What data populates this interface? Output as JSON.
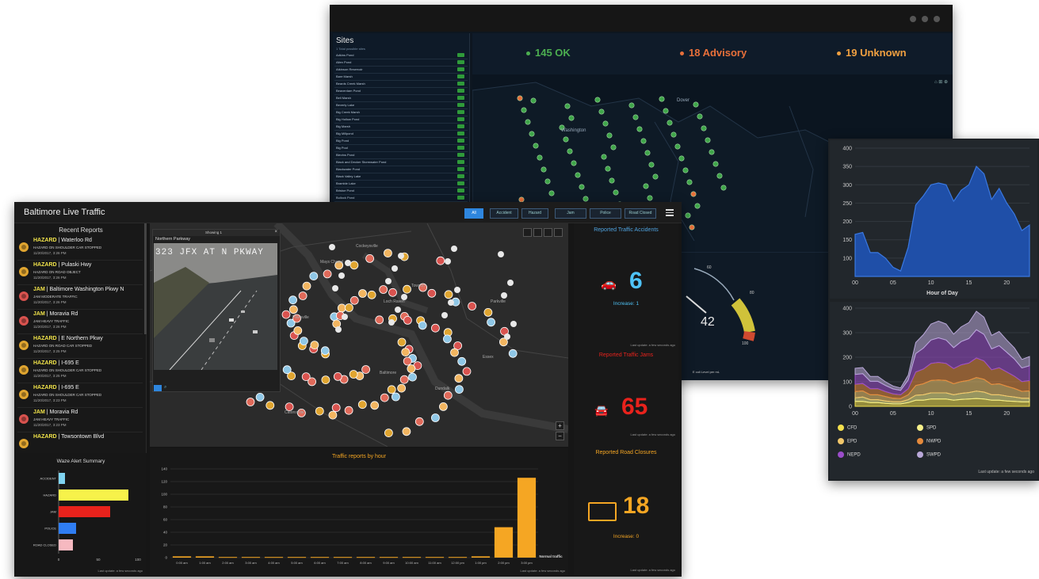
{
  "sites_window": {
    "panel_title": "Sites",
    "panel_subtitle": "1 Total possible sites",
    "sites": [
      "Adkins Pond",
      "Allen Pond",
      "Atkinson Reservoir",
      "Bare Marsh",
      "Beards Creek Marsh",
      "Beaverdam Pond",
      "Bell Marsh",
      "Beverly Lake",
      "Big Creek Marsh",
      "Big Hollow Pond",
      "Big Marsh",
      "Big Millpond",
      "Big Pond",
      "Big Pool",
      "Blevins Pond",
      "Black and Decker Stormwater Pond",
      "Blackwater Pond",
      "Black Valley Lake",
      "Bramble Lake",
      "Bristoe Pond",
      "Bullock Pond"
    ],
    "status_ok": "145 OK",
    "status_advisory": "18 Advisory",
    "status_unknown": "19 Unknown",
    "map_labels": [
      "Washington",
      "Dover"
    ],
    "gauge_value": "42",
    "gauge_ticks": [
      "60",
      "80",
      "100"
    ],
    "gauge_caption": "E coli Level per mL"
  },
  "chart_window": {
    "update_text": "Last update: a few seconds ago",
    "legend": [
      {
        "name": "CFD",
        "color": "#f4e04d"
      },
      {
        "name": "SPD",
        "color": "#f7f08a"
      },
      {
        "name": "EPD",
        "color": "#f2c76b"
      },
      {
        "name": "NWPD",
        "color": "#e58a3c"
      },
      {
        "name": "NEPD",
        "color": "#9b4dca"
      },
      {
        "name": "SWPD",
        "color": "#b9a8d9"
      }
    ]
  },
  "chart_data": [
    {
      "type": "area",
      "xlabel": "Hour of Day",
      "x": [
        0,
        1,
        2,
        3,
        4,
        5,
        6,
        7,
        8,
        9,
        10,
        11,
        12,
        13,
        14,
        15,
        16,
        17,
        18,
        19,
        20,
        21,
        22,
        23
      ],
      "series": [
        {
          "values": [
            165,
            170,
            115,
            115,
            100,
            75,
            65,
            130,
            245,
            270,
            300,
            305,
            300,
            255,
            285,
            300,
            350,
            330,
            260,
            290,
            250,
            220,
            175,
            190
          ]
        }
      ],
      "xticks": [
        "00",
        "05",
        "10",
        "15",
        "20"
      ],
      "yticks": [
        "100",
        "150",
        "200",
        "250",
        "300",
        "350",
        "400"
      ],
      "ylim": [
        50,
        400
      ]
    },
    {
      "type": "area",
      "x": [
        0,
        1,
        2,
        3,
        4,
        5,
        6,
        7,
        8,
        9,
        10,
        11,
        12,
        13,
        14,
        15,
        16,
        17,
        18,
        19,
        20,
        21,
        22,
        23
      ],
      "series": [
        {
          "name": "CFD",
          "values": [
            20,
            20,
            15,
            15,
            12,
            10,
            10,
            15,
            25,
            25,
            30,
            30,
            30,
            25,
            28,
            30,
            32,
            30,
            25,
            25,
            22,
            20,
            18,
            18
          ]
        },
        {
          "name": "SPD",
          "values": [
            15,
            18,
            12,
            12,
            10,
            8,
            8,
            12,
            20,
            22,
            25,
            25,
            25,
            22,
            25,
            26,
            30,
            28,
            22,
            22,
            20,
            18,
            15,
            15
          ]
        },
        {
          "name": "EPD",
          "values": [
            25,
            25,
            20,
            20,
            18,
            15,
            14,
            20,
            40,
            45,
            50,
            52,
            50,
            45,
            48,
            50,
            55,
            52,
            42,
            45,
            40,
            35,
            28,
            30
          ]
        },
        {
          "name": "NWPD",
          "values": [
            30,
            30,
            25,
            25,
            20,
            18,
            15,
            25,
            55,
            60,
            70,
            72,
            70,
            62,
            68,
            70,
            80,
            75,
            60,
            65,
            58,
            50,
            40,
            42
          ]
        },
        {
          "name": "NEPD",
          "values": [
            40,
            40,
            30,
            30,
            25,
            20,
            18,
            35,
            75,
            85,
            95,
            100,
            95,
            85,
            95,
            100,
            115,
            108,
            85,
            90,
            80,
            70,
            55,
            60
          ]
        },
        {
          "name": "SWPD",
          "values": [
            25,
            25,
            20,
            20,
            15,
            12,
            10,
            20,
            45,
            55,
            65,
            68,
            65,
            55,
            60,
            65,
            75,
            70,
            55,
            58,
            50,
            45,
            35,
            38
          ]
        }
      ],
      "xticks": [
        "00",
        "05",
        "10",
        "15",
        "20"
      ],
      "yticks": [
        "0",
        "100",
        "200",
        "300",
        "400"
      ],
      "ylim": [
        0,
        400
      ]
    },
    {
      "type": "bar",
      "title": "Waze Alert Summary",
      "categories": [
        "ACCIDENT",
        "HAZARD",
        "JAM",
        "POLICE",
        "ROAD CLOSED"
      ],
      "values": [
        8,
        88,
        65,
        22,
        18
      ],
      "colors": [
        "#7fd3f0",
        "#f7f24a",
        "#e8221c",
        "#2f7df2",
        "#f6b9c0"
      ],
      "xticks": [
        "0",
        "50",
        "100"
      ],
      "xlim": [
        0,
        100
      ]
    },
    {
      "type": "bar",
      "title": "Traffic reports by hour",
      "categories": [
        "0:00 am",
        "1:00 am",
        "2:00 am",
        "3:00 am",
        "4:00 am",
        "5:00 am",
        "6:00 am",
        "7:00 am",
        "8:00 am",
        "9:00 am",
        "10:00 am",
        "11:00 am",
        "12:00 pm",
        "1:00 pm",
        "2:00 pm",
        "3:00 pm"
      ],
      "values": [
        2,
        2,
        1,
        1,
        1,
        1,
        1,
        1,
        1,
        1,
        1,
        1,
        1,
        2,
        48,
        126
      ],
      "yticks": [
        "0",
        "20",
        "40",
        "60",
        "80",
        "100",
        "120",
        "140"
      ],
      "ylim": [
        0,
        140
      ],
      "legend": "Normal traffic"
    }
  ],
  "main_window": {
    "title": "Baltimore Live Traffic",
    "filters": [
      "All",
      "Accident",
      "Hazard",
      "Jam",
      "Police",
      "Road Closed"
    ],
    "reports_title": "Recent Reports",
    "reports": [
      {
        "type": "HAZARD",
        "road": "| Waterloo Rd",
        "desc": "HAZARD ON SHOULDER CAR STOPPED",
        "time": "11/20/2017, 3:26 PM",
        "color": "#e0a530"
      },
      {
        "type": "HAZARD",
        "road": "| Pulaski Hwy",
        "desc": "HAZARD ON ROAD OBJECT",
        "time": "11/20/2017, 3:26 PM",
        "color": "#e0a530"
      },
      {
        "type": "JAM",
        "road": "| Baltimore Washington Pkwy N",
        "desc": "JAM MODERATE TRAFFIC",
        "time": "11/20/2017, 3:26 PM",
        "color": "#d9534f"
      },
      {
        "type": "JAM",
        "road": "| Moravia Rd",
        "desc": "JAM HEAVY TRAFFIC",
        "time": "11/20/2017, 3:26 PM",
        "color": "#d9534f"
      },
      {
        "type": "HAZARD",
        "road": "| E Northern Pkwy",
        "desc": "HAZARD ON ROAD CAR STOPPED",
        "time": "11/20/2017, 3:25 PM",
        "color": "#e0a530"
      },
      {
        "type": "HAZARD",
        "road": "| I-695 E",
        "desc": "HAZARD ON SHOULDER CAR STOPPED",
        "time": "11/20/2017, 3:25 PM",
        "color": "#e0a530"
      },
      {
        "type": "HAZARD",
        "road": "| I-695 E",
        "desc": "HAZARD ON SHOULDER CAR STOPPED",
        "time": "11/20/2017, 3:23 PM",
        "color": "#e0a530"
      },
      {
        "type": "JAM",
        "road": "| Moravia Rd",
        "desc": "JAM HEAVY TRAFFIC",
        "time": "11/20/2017, 3:23 PM",
        "color": "#d9534f"
      },
      {
        "type": "HAZARD",
        "road": "| Towsontown Blvd",
        "desc": "",
        "time": "",
        "color": "#e0a530"
      }
    ],
    "panel_update": "Last update: a few seconds ago",
    "camera_window_title": "Showing 1",
    "camera_name": "Northern Parkway",
    "camera_overlay": "323 JFX AT N PKWAY",
    "map_labels": [
      "Cockeysville",
      "Mays Chapel",
      "Loch Raven",
      "Towson",
      "Parkville",
      "Pikesville",
      "Catonsville",
      "Baltimore",
      "Dundalk",
      "Essex"
    ],
    "accidents": {
      "title": "Reported Traffic Accidents",
      "value": "6",
      "sub": "Increase: 1",
      "color": "#4fc3f7"
    },
    "jams": {
      "title": "Reported Traffic Jams",
      "value": "65",
      "color": "#e8221c"
    },
    "closures": {
      "title": "Reported Road Closures",
      "value": "18",
      "sub": "Increase: 0",
      "color": "#f5a623"
    }
  }
}
